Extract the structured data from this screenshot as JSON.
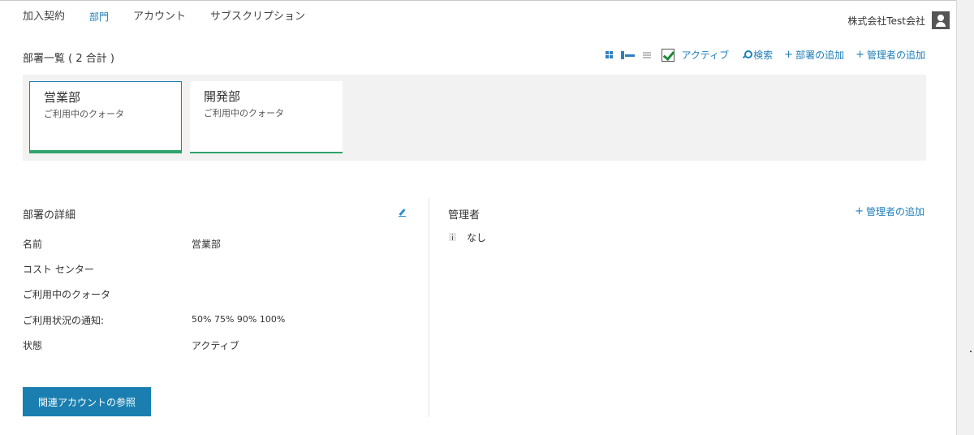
{
  "nav": {
    "tabs": [
      "加入契約",
      "部門",
      "アカウント",
      "サブスクリプション"
    ],
    "active_index": 1
  },
  "user": {
    "company": "株式会社Test会社",
    "avatar_icon": "user-avatar-icon"
  },
  "list": {
    "title": "部署一覧 ( 2 合計 )",
    "active_label": "アクティブ",
    "active_checked": true,
    "search_label": "検索",
    "add_department_label": "部署の追加",
    "add_admin_label": "管理者の追加"
  },
  "departments": [
    {
      "name": "営業部",
      "quota_label": "ご利用中のクォータ",
      "selected": true
    },
    {
      "name": "開発部",
      "quota_label": "ご利用中のクォータ",
      "selected": false
    }
  ],
  "details": {
    "title": "部署の詳細",
    "rows": [
      {
        "label": "名前",
        "value": "営業部"
      },
      {
        "label": "コスト センター",
        "value": ""
      },
      {
        "label": "ご利用中のクォータ",
        "value": ""
      },
      {
        "label": "ご利用状況の通知:",
        "value": "50% 75% 90% 100%"
      },
      {
        "label": "状態",
        "value": "アクティブ"
      }
    ],
    "button_label": "関連アカウントの参照"
  },
  "admins": {
    "title": "管理者",
    "add_label": "管理者の追加",
    "empty_text": "なし"
  },
  "colors": {
    "accent": "#1f7fb8",
    "button": "#1a7fb0",
    "success": "#2ea36b",
    "panel_bg": "#f2f2f2"
  }
}
